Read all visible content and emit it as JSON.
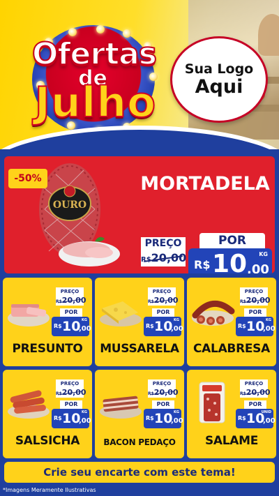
{
  "header": {
    "title_line1": "Ofertas",
    "title_line2": "de",
    "title_line3": "Julho",
    "logo_line1": "Sua Logo",
    "logo_line2": "Aqui"
  },
  "featured": {
    "discount": "-50%",
    "name": "MORTADELA",
    "brand_label": "OURO",
    "old_label": "PREÇO",
    "old_currency": "R$",
    "old_value": "20,00",
    "new_label": "POR",
    "currency": "R$",
    "price_int": "10",
    "price_dec": ",00",
    "unit": "KG"
  },
  "products": [
    {
      "name": "PRESUNTO",
      "old_label": "PREÇO",
      "old_currency": "R$",
      "old_value": "20,00",
      "new_label": "POR",
      "currency": "R$",
      "price_int": "10",
      "price_dec": ",00",
      "unit": "KG"
    },
    {
      "name": "MUSSARELA",
      "old_label": "PREÇO",
      "old_currency": "R$",
      "old_value": "20,00",
      "new_label": "POR",
      "currency": "R$",
      "price_int": "10",
      "price_dec": ",00",
      "unit": "KG"
    },
    {
      "name": "CALABRESA",
      "old_label": "PREÇO",
      "old_currency": "R$",
      "old_value": "20,00",
      "new_label": "POR",
      "currency": "R$",
      "price_int": "10",
      "price_dec": ",00",
      "unit": "KG"
    },
    {
      "name": "SALSICHA",
      "old_label": "PREÇO",
      "old_currency": "R$",
      "old_value": "20,00",
      "new_label": "POR",
      "currency": "R$",
      "price_int": "10",
      "price_dec": ",00",
      "unit": "KG"
    },
    {
      "name": "BACON PEDAÇO",
      "old_label": "PREÇO",
      "old_currency": "R$",
      "old_value": "20,00",
      "new_label": "POR",
      "currency": "R$",
      "price_int": "10",
      "price_dec": ",00",
      "unit": "KG"
    },
    {
      "name": "SALAME",
      "old_label": "PREÇO",
      "old_currency": "R$",
      "old_value": "20,00",
      "new_label": "POR",
      "currency": "R$",
      "price_int": "10",
      "price_dec": ",00",
      "unit": "UNID"
    }
  ],
  "footer": {
    "cta": "Crie seu encarte com este tema!",
    "disclaimer": "*Imagens Meramente Ilustrativas"
  },
  "colors": {
    "yellow": "#ffd21a",
    "red": "#e0202c",
    "blue": "#2244b8",
    "navy": "#1f3f9e"
  }
}
